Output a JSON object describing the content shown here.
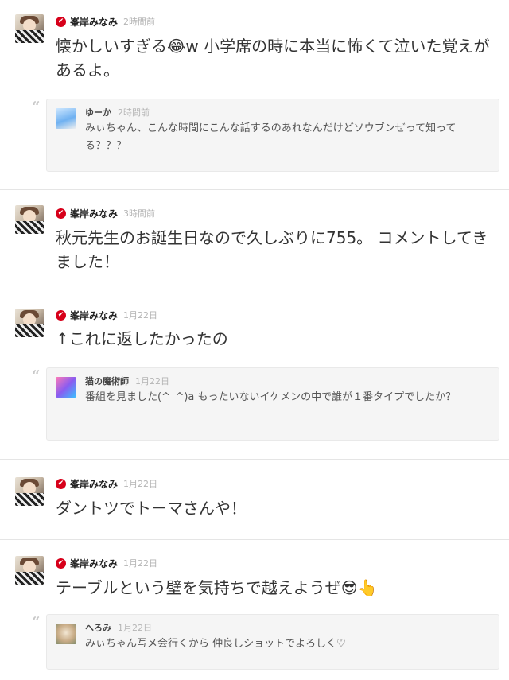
{
  "posts": [
    {
      "name": "峯岸みなみ",
      "time": "2時間前",
      "text": "懐かしいすぎる😂w 小学席の時に本当に怖くて泣いた覚えがあるよ。",
      "reply": {
        "name": "ゆーか",
        "time": "2時間前",
        "text": "みぃちゃん、こんな時間にこんな話するのあれなんだけどソウブンぜって知ってる？？？"
      }
    },
    {
      "name": "峯岸みなみ",
      "time": "3時間前",
      "text": "秋元先生のお誕生日なので久しぶりに755。 コメントしてきました！"
    },
    {
      "name": "峯岸みなみ",
      "time": "1月22日",
      "text": "↑これに返したかったの",
      "reply": {
        "name": "猫の魔術師",
        "time": "1月22日",
        "text": "番組を見ました(^_^)a もったいないイケメンの中で誰が１番タイプでしたか？"
      }
    },
    {
      "name": "峯岸みなみ",
      "time": "1月22日",
      "text": "ダントツでトーマさんや！"
    },
    {
      "name": "峯岸みなみ",
      "time": "1月22日",
      "text": "テーブルという壁を気持ちで越えようぜ😎👆",
      "reply": {
        "name": "へろみ",
        "time": "1月22日",
        "text": "みぃちゃん写メ会行くから 仲良しショットでよろしく♡"
      }
    }
  ],
  "icons": {
    "verified": "✔",
    "quote": "“"
  },
  "colors": {
    "verified": "#d7001a",
    "time": "#b5b5b5",
    "reply_bg": "#f5f5f5",
    "divider": "#e5e5e5"
  }
}
